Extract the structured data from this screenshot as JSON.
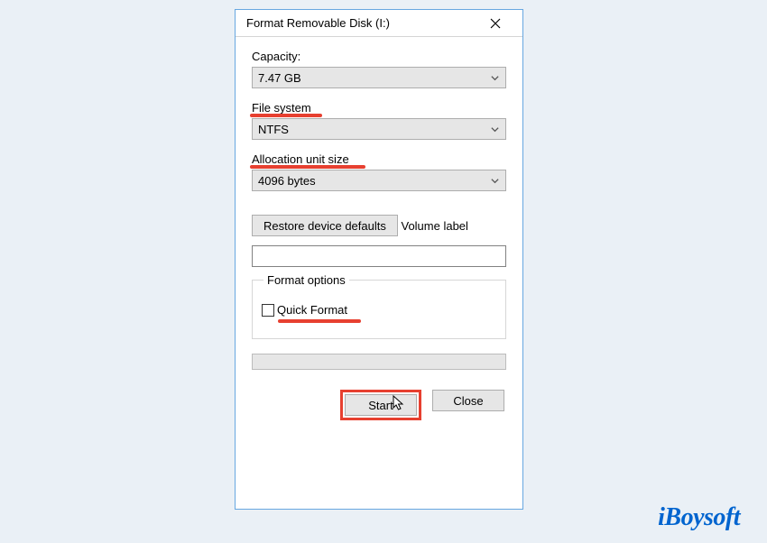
{
  "dialog": {
    "title": "Format Removable Disk (I:)",
    "capacity_label": "Capacity:",
    "capacity_value": "7.47 GB",
    "filesystem_label": "File system",
    "filesystem_value": "NTFS",
    "allocation_label": "Allocation unit size",
    "allocation_value": "4096 bytes",
    "restore_label": "Restore device defaults",
    "volume_label": "Volume label",
    "volume_value": "",
    "format_options_legend": "Format options",
    "quick_format_label": "Quick Format",
    "start_label": "Start",
    "close_label": "Close"
  },
  "watermark": "iBoysoft"
}
